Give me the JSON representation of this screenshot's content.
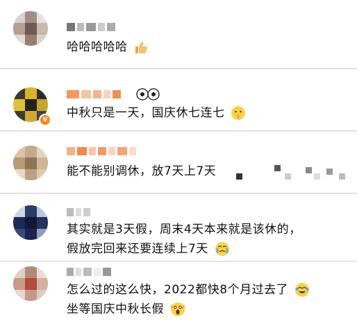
{
  "comments": [
    {
      "text_lines": [
        "哈哈哈哈哈"
      ],
      "emoji": "thumbs-up-icon"
    },
    {
      "text_lines": [
        "中秋只是一天，国庆休七连七"
      ],
      "emoji": "shush-face-icon"
    },
    {
      "text_lines": [
        "能不能别调休，放7天上7天"
      ],
      "emoji": ""
    },
    {
      "text_lines": [
        "其实就是3天假，周末4天本来就是该休的，",
        "假放完回来还要连续上7天"
      ],
      "emoji": "crying-face-icon"
    },
    {
      "text_lines": [
        "怎么过的这么快，2022都快8个月过去了",
        "坐等国庆中秋长假"
      ],
      "emoji": "laughing-crying-icon"
    }
  ],
  "colors": {
    "accent_badge": "#f28a1d",
    "text": "#111111",
    "background": "#ffffff"
  }
}
